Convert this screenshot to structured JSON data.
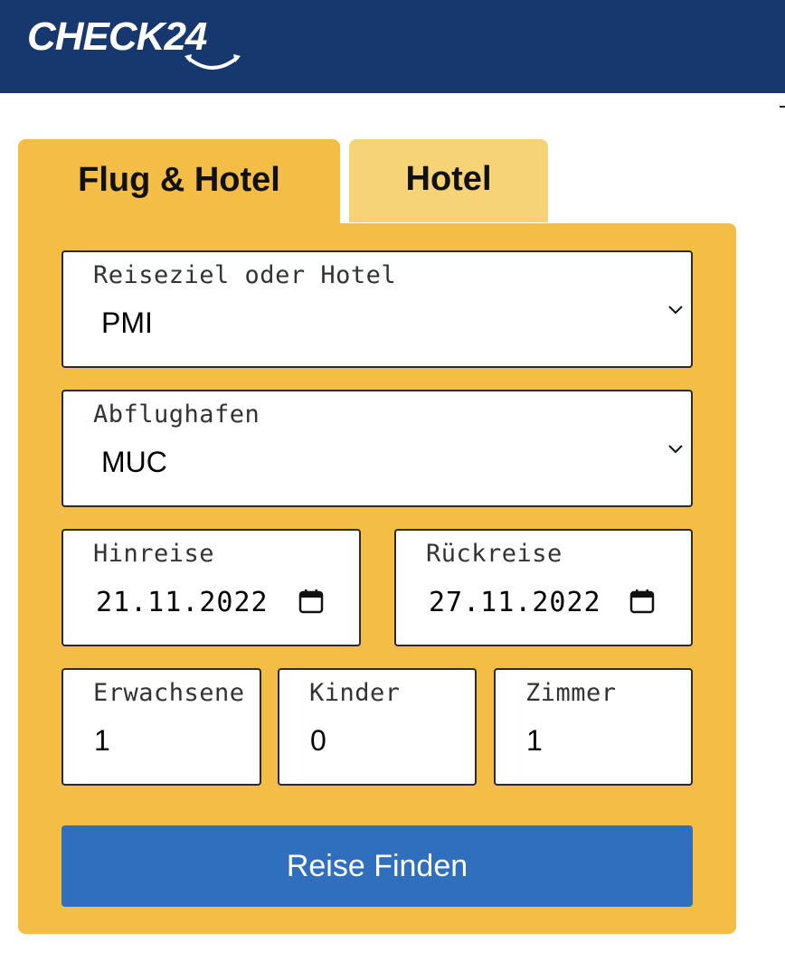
{
  "header": {
    "logo_text": "CHECK24"
  },
  "tabs": [
    {
      "label": "Flug & Hotel",
      "active": true
    },
    {
      "label": "Hotel",
      "active": false
    }
  ],
  "form": {
    "destination": {
      "label": "Reiseziel oder Hotel",
      "value": "PMI",
      "icon": "chevron-down-icon"
    },
    "departure_airport": {
      "label": "Abflughafen",
      "value": "MUC",
      "icon": "chevron-down-icon"
    },
    "outbound": {
      "label": "Hinreise",
      "value": "21.11.2022",
      "icon": "calendar-icon"
    },
    "return": {
      "label": "Rückreise",
      "value": "27.11.2022",
      "icon": "calendar-icon"
    },
    "adults": {
      "label": "Erwachsene",
      "value": "1"
    },
    "children": {
      "label": "Kinder",
      "value": "0"
    },
    "rooms": {
      "label": "Zimmer",
      "value": "1"
    },
    "submit_label": "Reise Finden"
  },
  "colors": {
    "header_bg": "#17376f",
    "panel_bg": "#f3bd46",
    "inactive_tab_bg": "#f7d377",
    "button_bg": "#2f6fbe"
  }
}
